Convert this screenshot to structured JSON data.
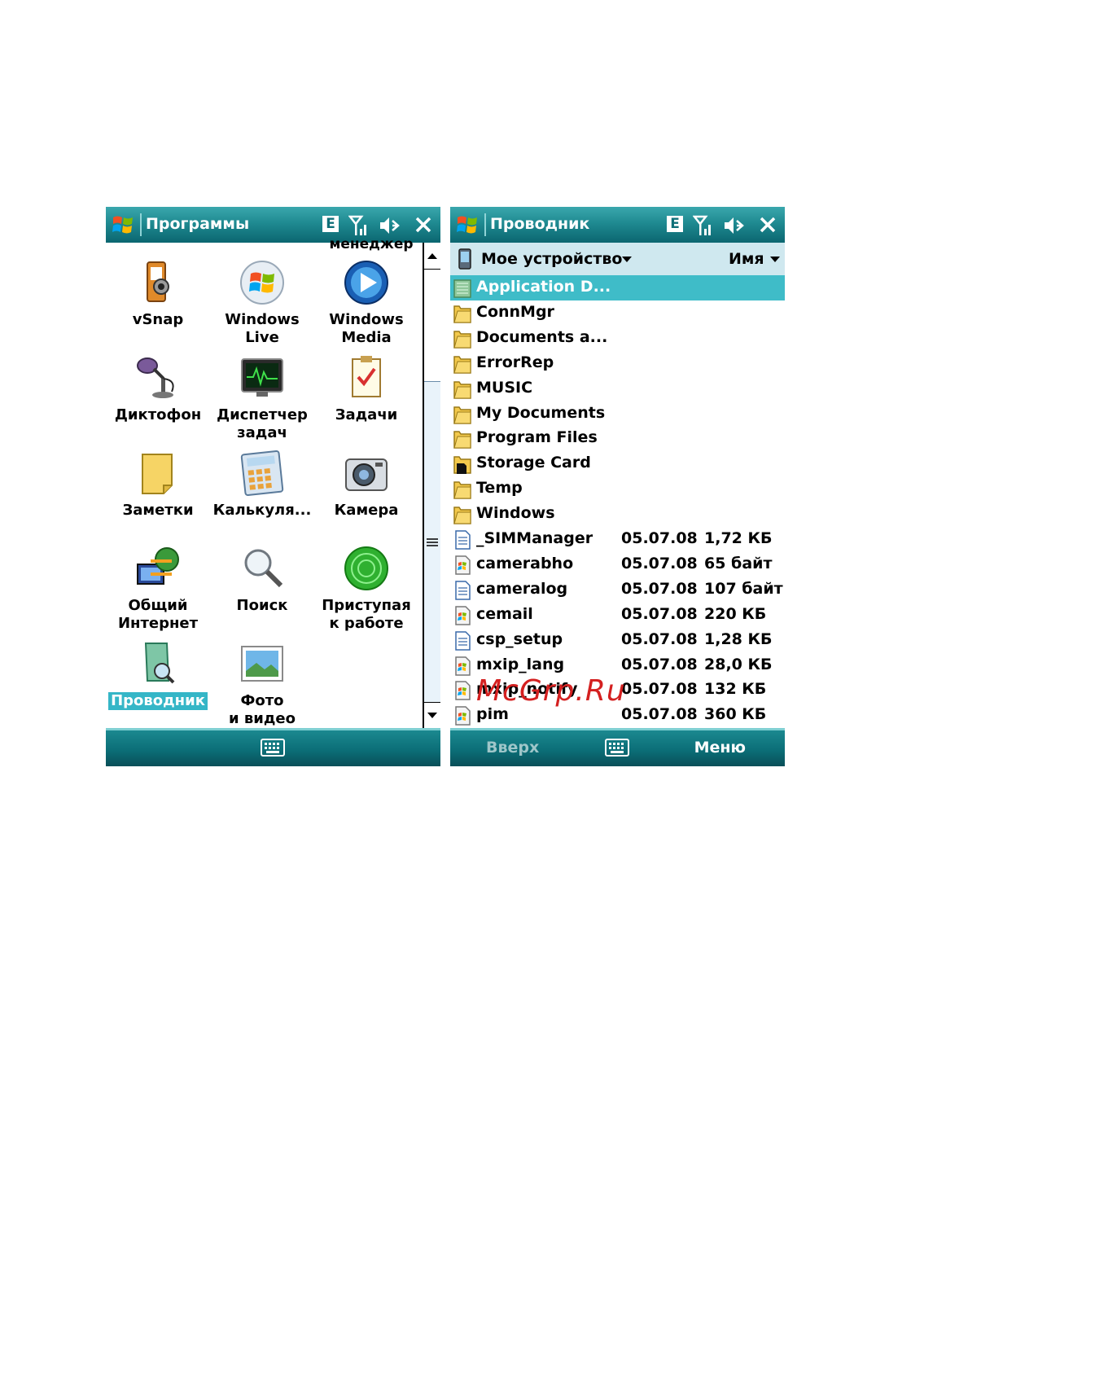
{
  "left_screen": {
    "title": "Программы",
    "status_e": "E",
    "overflow_label": "менеджер",
    "programs": [
      {
        "label": "vSnap",
        "icon": "vsnap-icon"
      },
      {
        "label": "Windows Live",
        "icon": "windows-live-icon"
      },
      {
        "label": "Windows Media",
        "icon": "windows-media-icon"
      },
      {
        "label": "Диктофон",
        "icon": "microphone-icon"
      },
      {
        "label": "Диспетчер задач",
        "icon": "task-manager-icon"
      },
      {
        "label": "Задачи",
        "icon": "tasks-icon"
      },
      {
        "label": "Заметки",
        "icon": "notes-icon"
      },
      {
        "label": "Калькуля...",
        "icon": "calculator-icon"
      },
      {
        "label": "Камера",
        "icon": "camera-icon"
      },
      {
        "label": "Общий Интернет",
        "icon": "internet-sharing-icon"
      },
      {
        "label": "Поиск",
        "icon": "search-icon"
      },
      {
        "label": "Приступая к работе",
        "icon": "getting-started-icon"
      },
      {
        "label": "Проводник",
        "icon": "explorer-icon",
        "selected": true
      },
      {
        "label": "Фото и видео",
        "icon": "photos-icon"
      }
    ]
  },
  "right_screen": {
    "title": "Проводник",
    "status_e": "E",
    "location": "Мое устройство",
    "sort_by": "Имя",
    "files": [
      {
        "name": "Application D...",
        "type": "folder-app",
        "selected": true
      },
      {
        "name": "ConnMgr",
        "type": "folder"
      },
      {
        "name": "Documents a...",
        "type": "folder"
      },
      {
        "name": "ErrorRep",
        "type": "folder"
      },
      {
        "name": "MUSIC",
        "type": "folder"
      },
      {
        "name": "My Documents",
        "type": "folder"
      },
      {
        "name": "Program Files",
        "type": "folder"
      },
      {
        "name": "Storage Card",
        "type": "storage"
      },
      {
        "name": "Temp",
        "type": "folder"
      },
      {
        "name": "Windows",
        "type": "folder"
      },
      {
        "name": "_SIMManager",
        "type": "doc",
        "date": "05.07.08",
        "size": "1,72 КБ"
      },
      {
        "name": "camerabho",
        "type": "app",
        "date": "05.07.08",
        "size": "65 байт"
      },
      {
        "name": "cameralog",
        "type": "doc",
        "date": "05.07.08",
        "size": "107 байт"
      },
      {
        "name": "cemail",
        "type": "app",
        "date": "05.07.08",
        "size": "220 КБ"
      },
      {
        "name": "csp_setup",
        "type": "doc",
        "date": "05.07.08",
        "size": "1,28 КБ"
      },
      {
        "name": "mxip_lang",
        "type": "app",
        "date": "05.07.08",
        "size": "28,0 КБ"
      },
      {
        "name": "mxip_notify",
        "type": "app",
        "date": "05.07.08",
        "size": "132 КБ"
      },
      {
        "name": "pim",
        "type": "app",
        "date": "05.07.08",
        "size": "360 КБ"
      }
    ],
    "softkeys": {
      "left": "Вверх",
      "right": "Меню"
    }
  },
  "watermark": "McGrp.Ru"
}
